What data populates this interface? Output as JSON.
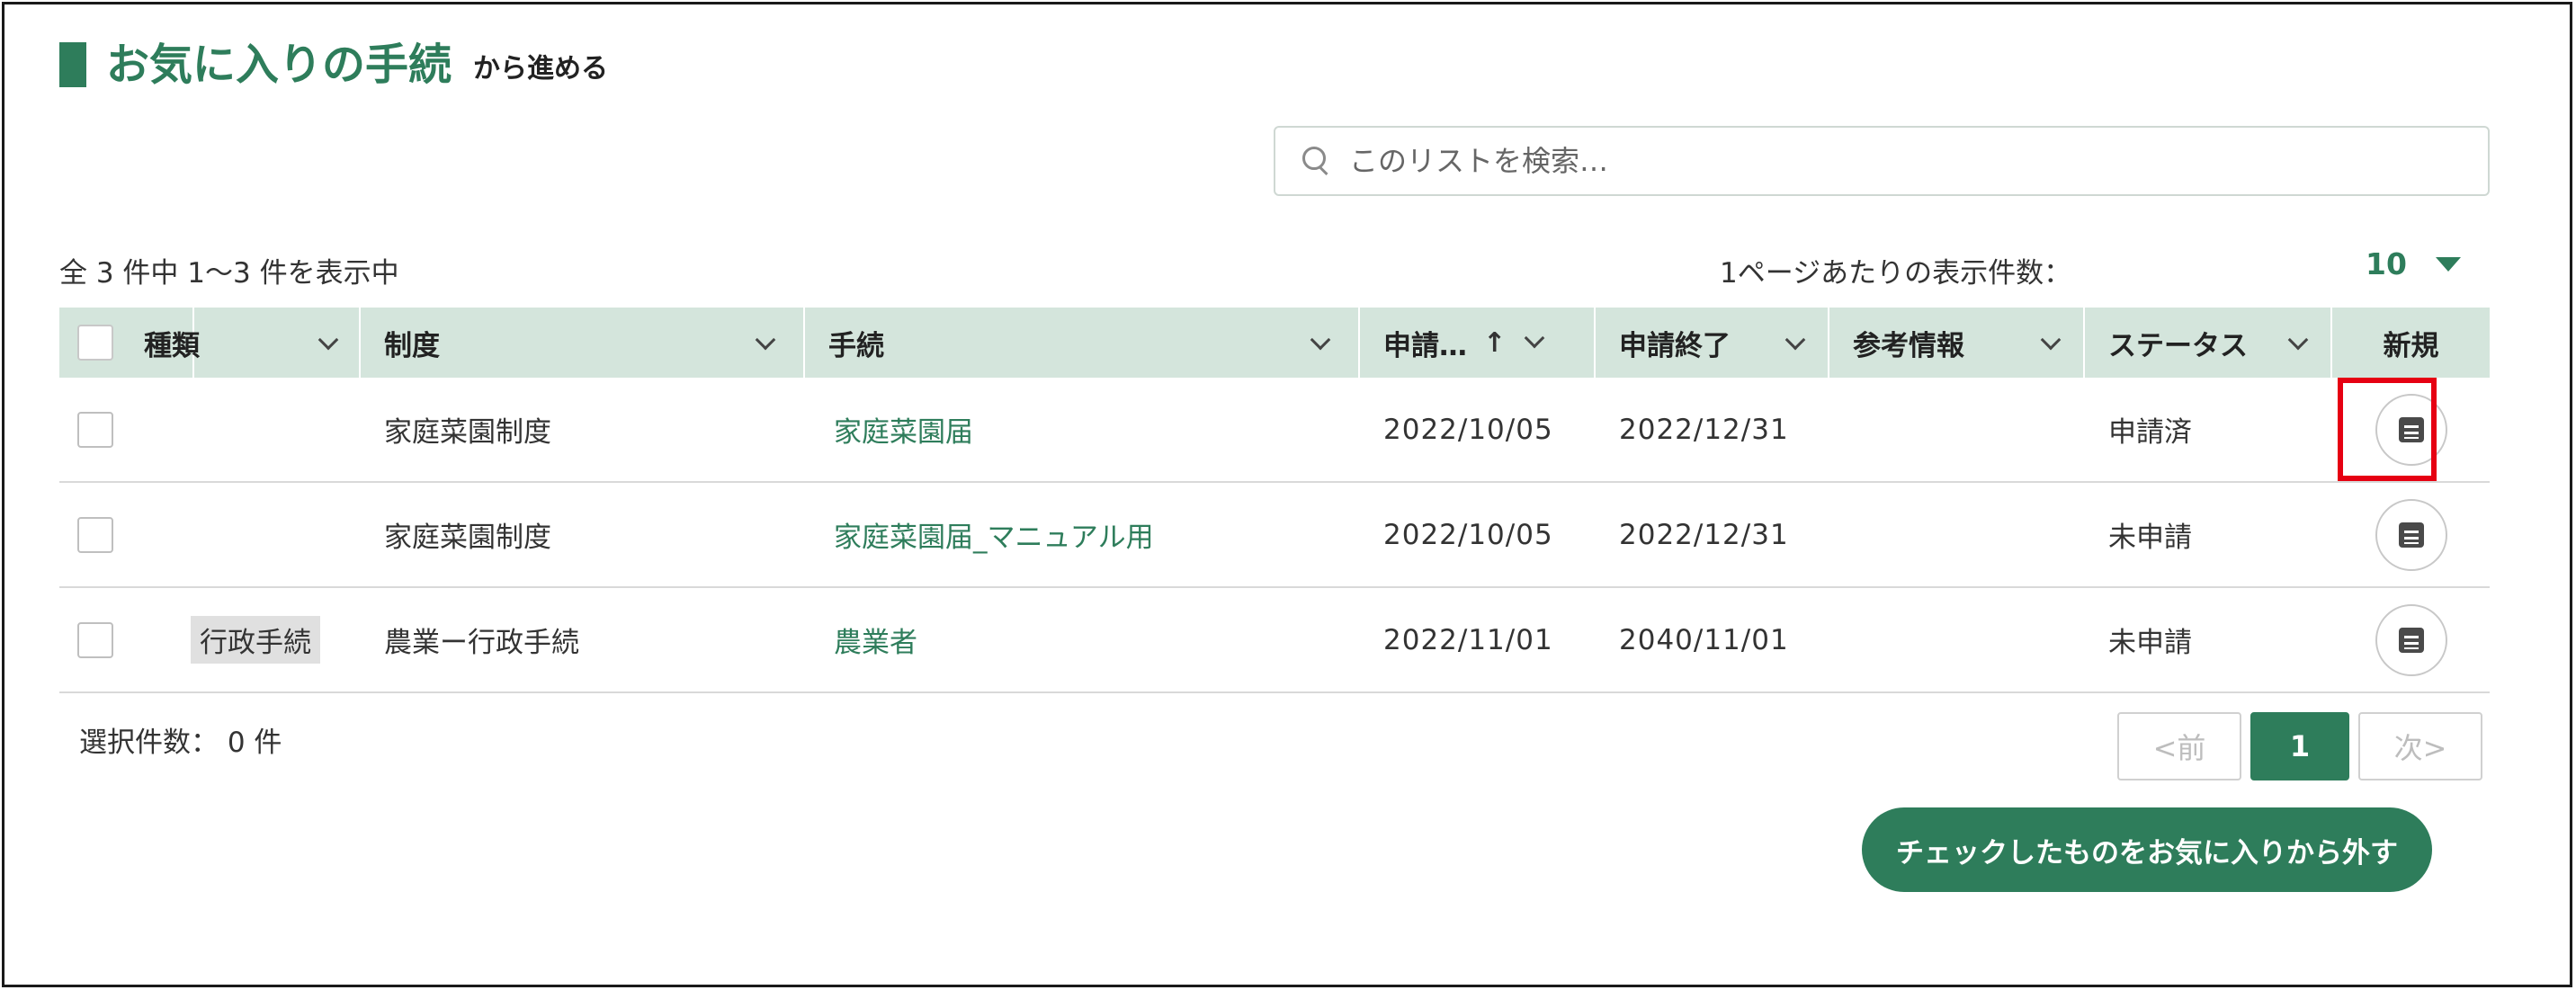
{
  "header": {
    "title": "お気に入りの手続",
    "subtitle": "から進める"
  },
  "search": {
    "placeholder": "このリストを検索…",
    "icon": "search-icon"
  },
  "summary": {
    "count_text": "全 3 件中 1〜3 件を表示中",
    "per_page_label": "1ページあたりの表示件数：",
    "per_page_value": "10"
  },
  "table": {
    "headers": {
      "type": "種類",
      "system": "制度",
      "procedure": "手続",
      "apply_start": "申請…",
      "apply_start_sort": "↑",
      "apply_end": "申請終了",
      "reference": "参考情報",
      "status": "ステータス",
      "new": "新規"
    },
    "rows": [
      {
        "type": "",
        "system": "家庭菜園制度",
        "procedure": "家庭菜園届",
        "apply_start": "2022/10/05",
        "apply_end": "2022/12/31",
        "reference": "",
        "status": "申請済"
      },
      {
        "type": "",
        "system": "家庭菜園制度",
        "procedure": "家庭菜園届_マニュアル用",
        "apply_start": "2022/10/05",
        "apply_end": "2022/12/31",
        "reference": "",
        "status": "未申請"
      },
      {
        "type": "行政手続",
        "system": "農業ー行政手続",
        "procedure": "農業者",
        "apply_start": "2022/11/01",
        "apply_end": "2040/11/01",
        "reference": "",
        "status": "未申請"
      }
    ]
  },
  "footer": {
    "selected_count": "選択件数： 0 件",
    "pager": {
      "prev": "<前",
      "current": "1",
      "next": "次>"
    },
    "remove_button": "チェックしたものをお気に入りから外す"
  },
  "colors": {
    "accent": "#2e7d5b",
    "header_bg": "#d4e5dc",
    "highlight": "#e60012"
  }
}
